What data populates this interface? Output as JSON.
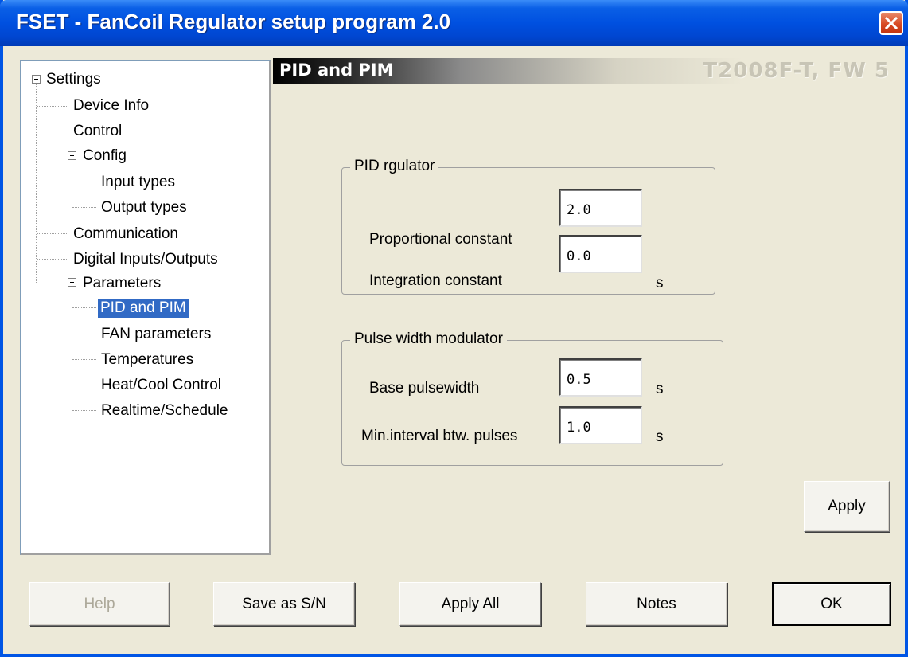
{
  "window": {
    "title": "FSET - FanCoil Regulator setup program 2.0"
  },
  "tree": {
    "root": "Settings",
    "device_info": "Device Info",
    "control": "Control",
    "config": "Config",
    "input_types": "Input types",
    "output_types": "Output types",
    "communication": "Communication",
    "digital_io": "Digital Inputs/Outputs",
    "parameters": "Parameters",
    "pid_pim": "PID and PIM",
    "fan_parameters": "FAN parameters",
    "temperatures": "Temperatures",
    "heat_cool": "Heat/Cool Control",
    "realtime": "Realtime/Schedule"
  },
  "header": {
    "section": "PID and PIM",
    "device": "T2008F-T, FW 5"
  },
  "pid": {
    "legend": "PID rgulator",
    "proportional_label": "Proportional constant",
    "proportional_value": "2.0",
    "integration_label": "Integration constant",
    "integration_value": "0.0",
    "integration_unit": "s"
  },
  "pwm": {
    "legend": "Pulse width modulator",
    "base_label": "Base pulsewidth",
    "base_value": "0.5",
    "base_unit": "s",
    "min_label": "Min.interval btw. pulses",
    "min_value": "1.0",
    "min_unit": "s"
  },
  "buttons": {
    "apply": "Apply",
    "help": "Help",
    "save_sn": "Save as S/N",
    "apply_all": "Apply All",
    "notes": "Notes",
    "ok": "OK"
  }
}
